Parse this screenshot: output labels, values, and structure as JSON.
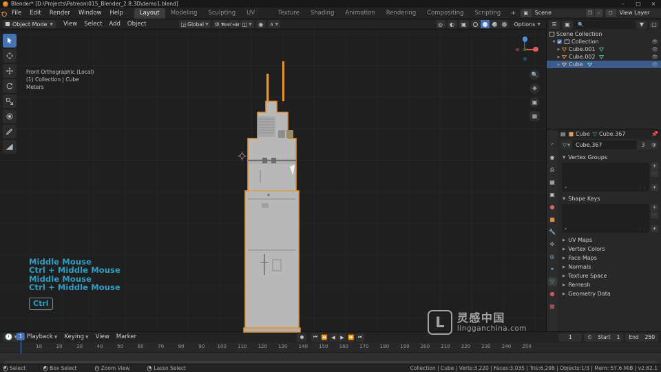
{
  "window": {
    "title": "Blender* [D:\\Projects\\Patreon\\015_Blender_2.8.3D\\demo1.blend]",
    "minimize": "–",
    "maximize": "□",
    "close": "×"
  },
  "topbar": {
    "menus": [
      "File",
      "Edit",
      "Render",
      "Window",
      "Help"
    ],
    "tabs": [
      {
        "label": "Layout",
        "active": true
      },
      {
        "label": "Modeling",
        "active": false
      },
      {
        "label": "Sculpting",
        "active": false
      },
      {
        "label": "UV Editing",
        "active": false
      },
      {
        "label": "Texture Paint",
        "active": false
      },
      {
        "label": "Shading",
        "active": false
      },
      {
        "label": "Animation",
        "active": false
      },
      {
        "label": "Rendering",
        "active": false
      },
      {
        "label": "Compositing",
        "active": false
      },
      {
        "label": "Scripting",
        "active": false
      }
    ],
    "add_tab": "+",
    "scene": {
      "name": "Scene",
      "new_icon": "❐",
      "unlink_icon": "×"
    },
    "view_layer": {
      "name": "View Layer",
      "new_icon": "❐",
      "unlink_icon": "×"
    }
  },
  "viewport": {
    "mode": "Object Mode",
    "menus": [
      "View",
      "Select",
      "Add",
      "Object"
    ],
    "transform_orientation": "Global",
    "options_label": "Options",
    "info_lines": [
      "Front Orthographic (Local)",
      "(1) Collection | Cube",
      "Meters"
    ],
    "screencast_keys": [
      "Middle Mouse",
      "Ctrl + Middle Mouse",
      "Middle Mouse",
      "Ctrl + Middle Mouse"
    ],
    "screencast_box": "Ctrl",
    "tools": [
      {
        "name": "tweak-tool",
        "active": true
      },
      {
        "name": "cursor-tool",
        "active": false
      },
      {
        "name": "move-tool",
        "active": false
      },
      {
        "name": "rotate-tool",
        "active": false
      },
      {
        "name": "scale-tool",
        "active": false
      },
      {
        "name": "transform-tool",
        "active": false
      },
      {
        "name": "annotate-tool",
        "active": false
      },
      {
        "name": "measure-tool",
        "active": false
      }
    ],
    "gizmo_axes": [
      {
        "label": "X",
        "color": "#e05a5a"
      },
      {
        "label": "Y",
        "color": "#93cc3b"
      },
      {
        "label": "Z",
        "color": "#4b8fe0"
      }
    ],
    "nav_buttons": [
      "zoom-icon",
      "pan-icon",
      "camera-icon",
      "ortho-icon"
    ],
    "shading_modes": [
      "wireframe",
      "solid",
      "material",
      "rendered"
    ],
    "active_shading": "solid"
  },
  "watermark": {
    "mark": "L",
    "chinese": "灵感中国",
    "english": "lingganchina.com"
  },
  "outliner": {
    "search_placeholder": "",
    "rows": [
      {
        "label": "Scene Collection",
        "indent": 0,
        "icon": "collection-icon",
        "selected": false,
        "eye": false,
        "mesh": false
      },
      {
        "label": "Collection",
        "indent": 1,
        "icon": "collection-icon",
        "selected": false,
        "eye": true,
        "mesh": false,
        "checkbox": true
      },
      {
        "label": "Cube.001",
        "indent": 2,
        "icon": "mesh-icon",
        "selected": false,
        "eye": true,
        "mesh": true
      },
      {
        "label": "Cube.002",
        "indent": 2,
        "icon": "mesh-icon",
        "selected": false,
        "eye": true,
        "mesh": true
      },
      {
        "label": "Cube",
        "indent": 2,
        "icon": "mesh-icon",
        "selected": true,
        "eye": true,
        "mesh": true
      }
    ]
  },
  "properties": {
    "breadcrumb_object": "Cube",
    "breadcrumb_data": "Cube.367",
    "data_name": "Cube.367",
    "user_count": "3",
    "sections": [
      {
        "label": "Vertex Groups",
        "open": true,
        "list": true
      },
      {
        "label": "Shape Keys",
        "open": true,
        "list": true
      },
      {
        "label": "UV Maps",
        "open": false,
        "list": false
      },
      {
        "label": "Vertex Colors",
        "open": false,
        "list": false
      },
      {
        "label": "Face Maps",
        "open": false,
        "list": false
      },
      {
        "label": "Normals",
        "open": false,
        "list": false
      },
      {
        "label": "Texture Space",
        "open": false,
        "list": false
      },
      {
        "label": "Remesh",
        "open": false,
        "list": false
      },
      {
        "label": "Geometry Data",
        "open": false,
        "list": false
      }
    ],
    "tabs": [
      {
        "name": "tool-tab",
        "glyph": "⚒",
        "color": "#c6c6c6",
        "active": false
      },
      {
        "name": "render-tab",
        "glyph": "◉",
        "color": "#c6c6c6",
        "active": false
      },
      {
        "name": "output-tab",
        "glyph": "⎙",
        "color": "#c6c6c6",
        "active": false
      },
      {
        "name": "view-layer-tab",
        "glyph": "☷",
        "color": "#c6c6c6",
        "active": false
      },
      {
        "name": "scene-tab",
        "glyph": "▣",
        "color": "#c6c6c6",
        "active": false
      },
      {
        "name": "world-tab",
        "glyph": "●",
        "color": "#d06a6a",
        "active": false
      },
      {
        "name": "object-tab",
        "glyph": "■",
        "color": "#e08b3a",
        "active": false
      },
      {
        "name": "modifier-tab",
        "glyph": "⚙",
        "color": "#4b8fe0",
        "active": false
      },
      {
        "name": "particles-tab",
        "glyph": "⁂",
        "color": "#c6c6c6",
        "active": false
      },
      {
        "name": "physics-tab",
        "glyph": "◌",
        "color": "#6fb3e0",
        "active": false
      },
      {
        "name": "constraints-tab",
        "glyph": "⛓",
        "color": "#6fb3e0",
        "active": false
      },
      {
        "name": "object-data-tab",
        "glyph": "▽",
        "color": "#4fbf8f",
        "active": true
      },
      {
        "name": "material-tab",
        "glyph": "●",
        "color": "#d05a6a",
        "active": false
      },
      {
        "name": "texture-tab",
        "glyph": "▦",
        "color": "#d05a6a",
        "active": false
      }
    ]
  },
  "timeline": {
    "editor_icon": "clock-icon",
    "menus": [
      "Playback",
      "Keying",
      "View",
      "Marker"
    ],
    "transport": [
      "⏮",
      "⏪",
      "◀",
      "▶",
      "⏩",
      "⏭"
    ],
    "current_frame": "1",
    "start_label": "Start",
    "start_value": "1",
    "end_label": "End",
    "end_value": "250",
    "playhead_frame": "1",
    "ticks": [
      "10",
      "20",
      "30",
      "40",
      "50",
      "60",
      "70",
      "80",
      "90",
      "100",
      "110",
      "120",
      "130",
      "140",
      "150",
      "160",
      "170",
      "180",
      "190",
      "200",
      "210",
      "220",
      "230",
      "240",
      "250"
    ]
  },
  "statusbar": {
    "hints": [
      {
        "label": "Select",
        "button": "left"
      },
      {
        "label": "Box Select",
        "button": "left"
      },
      {
        "label": "Zoom View",
        "button": "middle"
      },
      {
        "label": "Lasso Select",
        "button": "right"
      }
    ],
    "stats": "Collection | Cube | Verts:3,220 | Faces:3,035 | Tris:6,298 | Objects:1/3 | Mem: 57.6 MiB | v2.82.1"
  }
}
